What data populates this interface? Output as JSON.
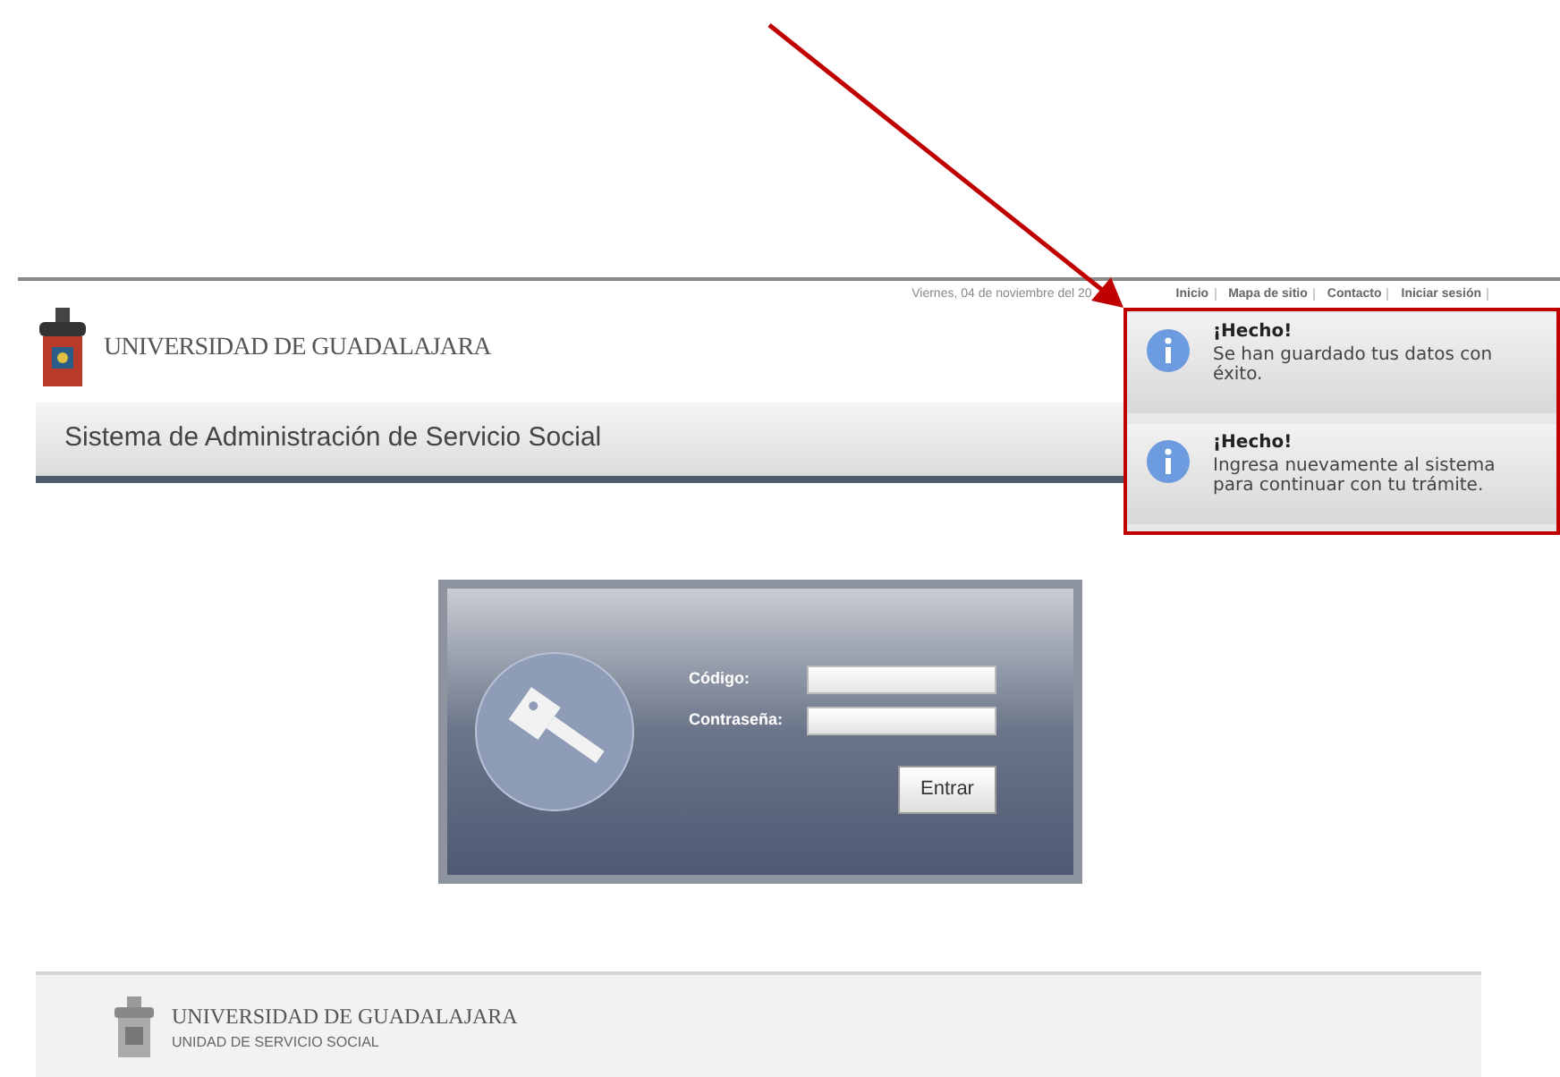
{
  "top_bar": {
    "date": "Viernes, 04 de noviembre del 20",
    "links": [
      "Inicio",
      "Mapa de sitio",
      "Contacto",
      "Iniciar sesión"
    ]
  },
  "header": {
    "university": "UNIVERSIDAD DE GUADALAJARA",
    "system_title": "Sistema de Administración de Servicio Social"
  },
  "login": {
    "fields": [
      {
        "label": "Código:"
      },
      {
        "label": "Contraseña:"
      }
    ],
    "button": "Entrar"
  },
  "notifications": [
    {
      "title": "¡Hecho!",
      "message": "Se han guardado tus datos con éxito."
    },
    {
      "title": "¡Hecho!",
      "message": "Ingresa nuevamente al sistema para continuar con tu trámite."
    }
  ],
  "footer": {
    "university": "UNIVERSIDAD DE GUADALAJARA",
    "unit": "UNIDAD DE SERVICIO SOCIAL"
  }
}
